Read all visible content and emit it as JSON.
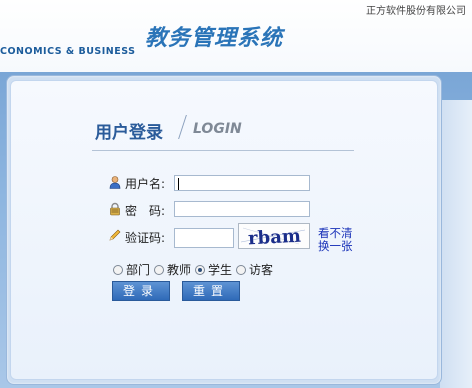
{
  "header": {
    "company": "正方软件股份有限公司",
    "system_title": "教务管理系统",
    "school_en": "CONOMICS & BUSINESS"
  },
  "login": {
    "title_cn": "用户登录",
    "title_en": "LOGIN",
    "username_label": "用户名:",
    "password_label": "密　码:",
    "captcha_label": "验证码:",
    "username_value": "",
    "password_value": "",
    "captcha_value": "",
    "captcha_text": "rbam",
    "captcha_refresh_line1": "看不清",
    "captcha_refresh_line2": "换一张",
    "roles": [
      {
        "label": "部门",
        "selected": false
      },
      {
        "label": "教师",
        "selected": false
      },
      {
        "label": "学生",
        "selected": true
      },
      {
        "label": "访客",
        "selected": false
      }
    ],
    "login_button": "登录",
    "reset_button": "重置"
  }
}
